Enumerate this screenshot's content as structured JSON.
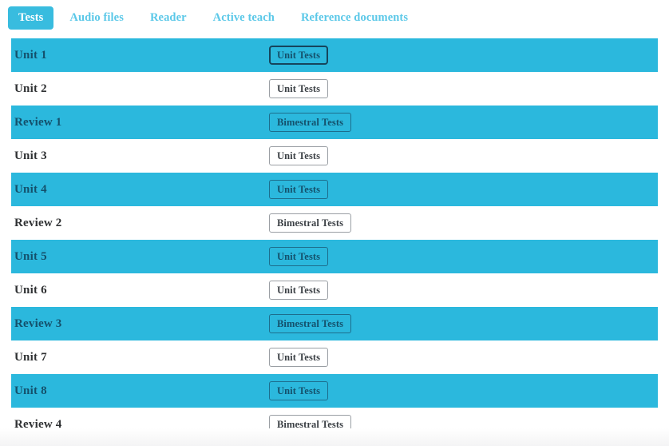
{
  "page": {
    "title": "Tests",
    "colors": {
      "accent_cyan": "#2bb8dd",
      "tab_active_bg": "#38bcdf",
      "tab_inactive_text": "#5bc8e8",
      "highlight_text": "#14506b",
      "row_text": "#2f3133",
      "button_border": "#9a9fa4",
      "focused_button_border": "#16455c"
    }
  },
  "tabs": [
    {
      "label": "Tests",
      "active": true
    },
    {
      "label": "Audio files",
      "active": false
    },
    {
      "label": "Reader",
      "active": false
    },
    {
      "label": "Active teach",
      "active": false
    },
    {
      "label": "Reference documents",
      "active": false
    }
  ],
  "rows": [
    {
      "label": "Unit 1",
      "button": "Unit Tests",
      "highlight": true,
      "focused": true
    },
    {
      "label": "Unit 2",
      "button": "Unit Tests",
      "highlight": false,
      "focused": false
    },
    {
      "label": "Review 1",
      "button": "Bimestral Tests",
      "highlight": true,
      "focused": false
    },
    {
      "label": "Unit 3",
      "button": "Unit Tests",
      "highlight": false,
      "focused": false
    },
    {
      "label": "Unit 4",
      "button": "Unit Tests",
      "highlight": true,
      "focused": false
    },
    {
      "label": "Review 2",
      "button": "Bimestral Tests",
      "highlight": false,
      "focused": false
    },
    {
      "label": "Unit 5",
      "button": "Unit Tests",
      "highlight": true,
      "focused": false
    },
    {
      "label": "Unit 6",
      "button": "Unit Tests",
      "highlight": false,
      "focused": false
    },
    {
      "label": "Review 3",
      "button": "Bimestral Tests",
      "highlight": true,
      "focused": false
    },
    {
      "label": "Unit 7",
      "button": "Unit Tests",
      "highlight": false,
      "focused": false
    },
    {
      "label": "Unit 8",
      "button": "Unit Tests",
      "highlight": true,
      "focused": false
    },
    {
      "label": "Review 4",
      "button": "Bimestral Tests",
      "highlight": false,
      "focused": false
    }
  ]
}
